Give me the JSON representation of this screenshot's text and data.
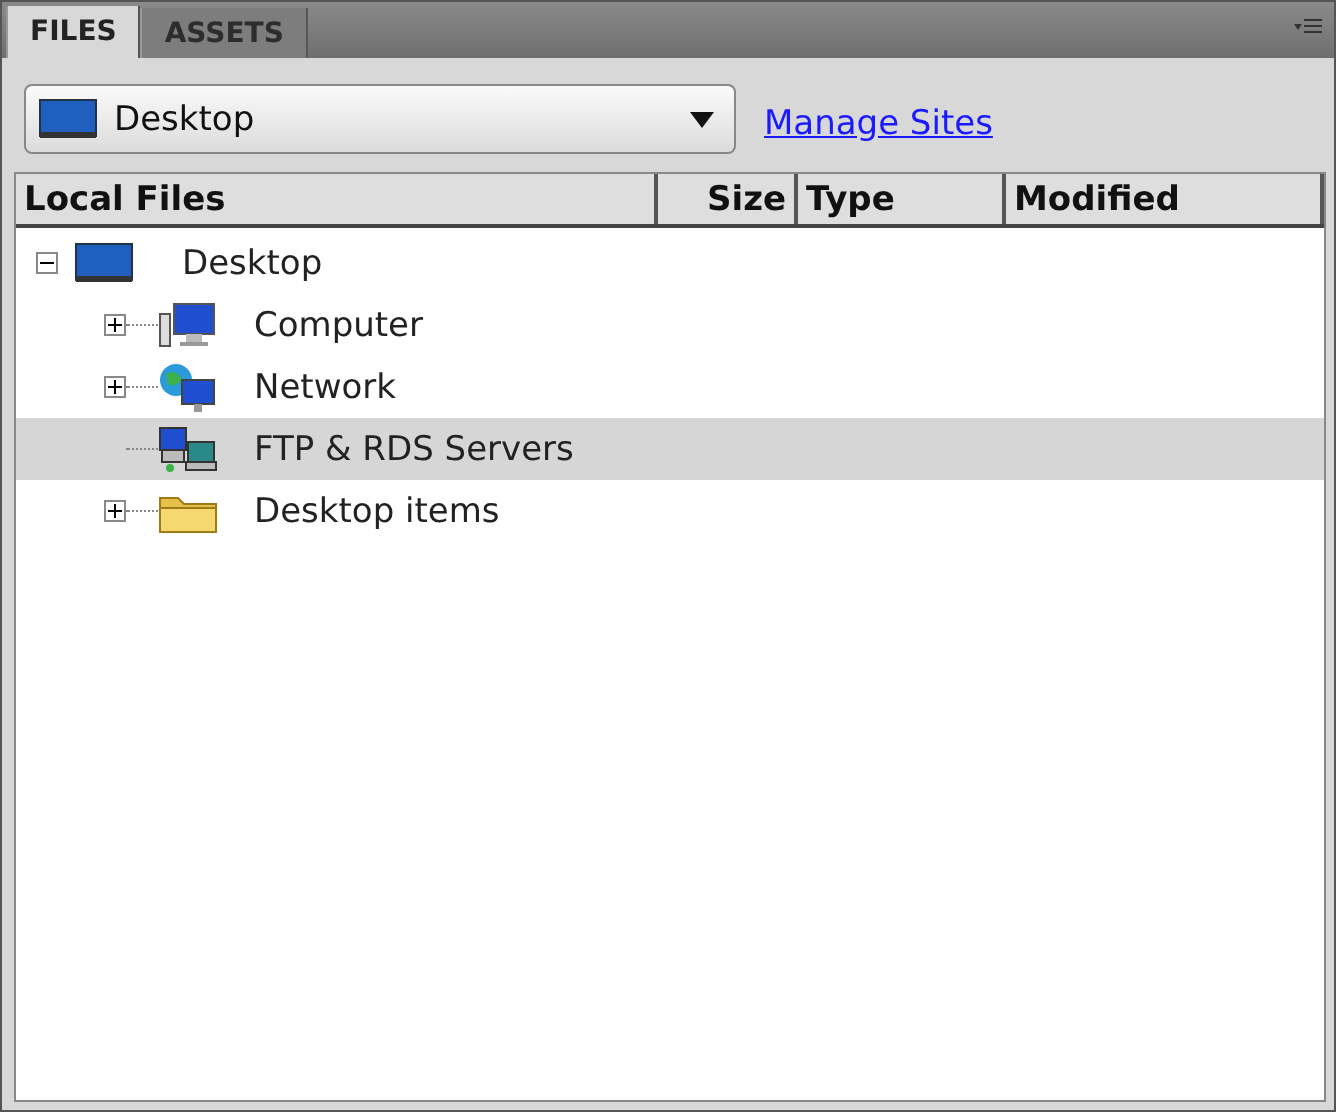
{
  "tabs": [
    {
      "label": "FILES",
      "selected": true
    },
    {
      "label": "ASSETS",
      "selected": false
    }
  ],
  "site_select": {
    "value": "Desktop"
  },
  "manage_sites_link": "Manage Sites",
  "columns": [
    "Local Files",
    "Size",
    "Type",
    "Modified"
  ],
  "tree": [
    {
      "label": "Desktop",
      "kind": "desktop",
      "expandable": true,
      "expanded": true,
      "selected": false,
      "children": [
        {
          "label": "Computer",
          "kind": "computer",
          "expandable": true,
          "expanded": false,
          "selected": false
        },
        {
          "label": "Network",
          "kind": "network",
          "expandable": true,
          "expanded": false,
          "selected": false
        },
        {
          "label": "FTP & RDS Servers",
          "kind": "servers",
          "expandable": false,
          "expanded": false,
          "selected": true
        },
        {
          "label": "Desktop items",
          "kind": "folder",
          "expandable": true,
          "expanded": false,
          "selected": false
        }
      ]
    }
  ]
}
